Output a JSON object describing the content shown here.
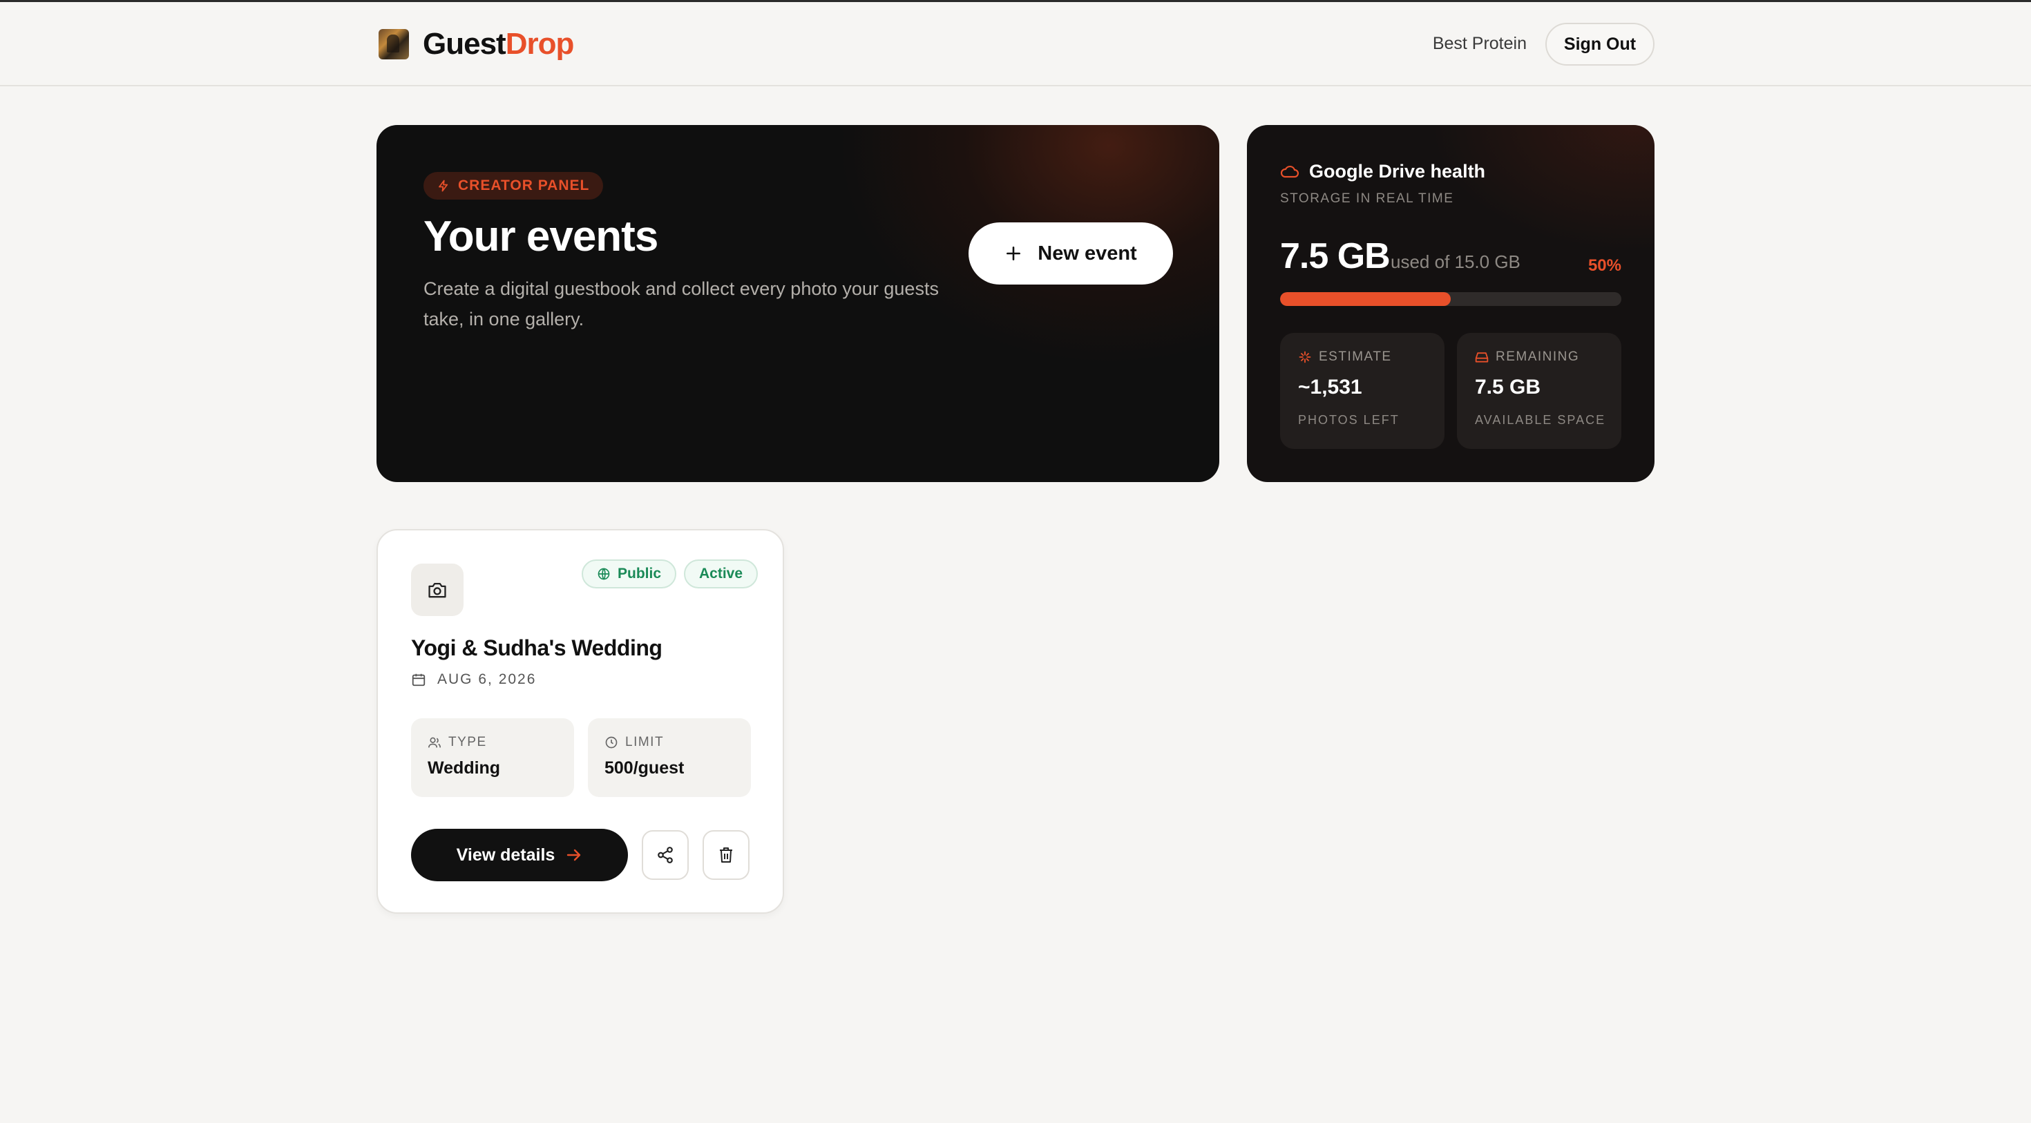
{
  "app": {
    "brand_part1": "Guest",
    "brand_part2": "Drop",
    "brand_accent_color": "#e8502a"
  },
  "header": {
    "user_name": "Best Protein",
    "signout_label": "Sign Out"
  },
  "hero": {
    "badge": "CREATOR PANEL",
    "title": "Your events",
    "description": "Create a digital guestbook and collect every photo your guests take, in one gallery.",
    "new_event_label": "New event",
    "icons": {
      "badge": "bolt-icon",
      "new_event": "plus-icon"
    }
  },
  "drive": {
    "title": "Google Drive health",
    "subtitle": "STORAGE IN REAL TIME",
    "used": "7.5 GB",
    "of_total": "used of 15.0 GB",
    "percent_label": "50%",
    "used_fraction": 0.5,
    "estimate": {
      "label": "ESTIMATE",
      "value": "~1,531",
      "sub": "PHOTOS LEFT"
    },
    "remaining": {
      "label": "REMAINING",
      "value": "7.5 GB",
      "sub": "AVAILABLE SPACE"
    },
    "icons": {
      "title": "cloud-icon",
      "estimate": "sparkle-icon",
      "remaining": "drive-icon"
    }
  },
  "events": [
    {
      "title": "Yogi & Sudha's Wedding",
      "date": "AUG 6, 2026",
      "visibility": "Public",
      "status": "Active",
      "type_label": "TYPE",
      "type_value": "Wedding",
      "limit_label": "LIMIT",
      "limit_value": "500/guest",
      "view_label": "View details",
      "icons": {
        "thumb": "camera-icon",
        "date": "calendar-icon",
        "type": "users-icon",
        "limit": "clock-icon",
        "share": "share-icon",
        "delete": "trash-icon"
      }
    }
  ]
}
